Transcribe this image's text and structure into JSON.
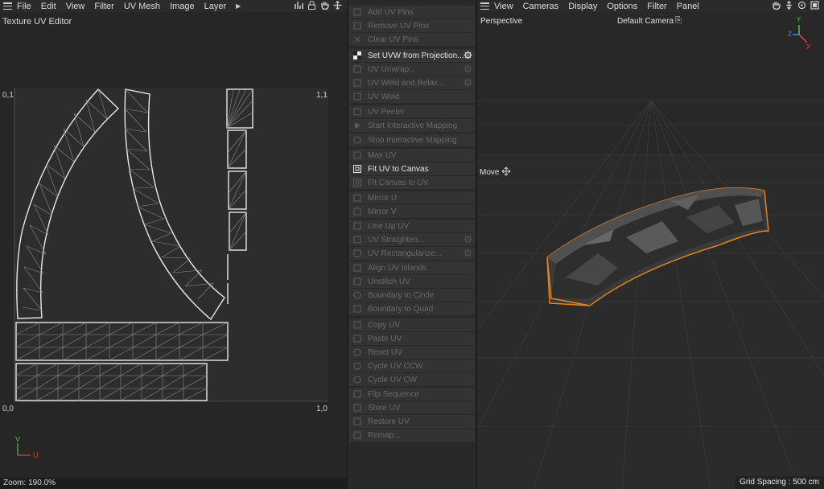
{
  "uv_editor": {
    "menu": [
      "File",
      "Edit",
      "View",
      "Filter",
      "UV Mesh",
      "Image",
      "Layer"
    ],
    "title": "Texture UV Editor",
    "corners": {
      "top_left": "0,1",
      "top_right": "1,1",
      "bottom_left": "0,0",
      "bottom_right": "1,0"
    },
    "axis": {
      "v": "V",
      "u": "U"
    },
    "status": "Zoom: 190.0%",
    "accent_colors": {
      "u_axis": "#e0453a",
      "v_axis": "#4bc24b"
    }
  },
  "commands": [
    {
      "label": "Add UV Pins",
      "enabled": false,
      "icon": "pin-icon"
    },
    {
      "label": "Remove UV Pins",
      "enabled": false,
      "icon": "pin-remove-icon"
    },
    {
      "label": "Clear UV Pins",
      "enabled": false,
      "icon": "x-icon"
    },
    {
      "label": "Set UVW from Projection...",
      "enabled": true,
      "icon": "checker-icon",
      "gear": true
    },
    {
      "label": "UV Unwrap...",
      "enabled": false,
      "icon": "unwrap-icon",
      "gear": true
    },
    {
      "label": "UV Weld and Relax...",
      "enabled": false,
      "icon": "weld-icon",
      "gear": true
    },
    {
      "label": "UV Weld",
      "enabled": false,
      "icon": "weld-icon"
    },
    {
      "label": "UV Peeler",
      "enabled": false,
      "icon": "peeler-icon"
    },
    {
      "label": "Start Interactive Mapping",
      "enabled": false,
      "icon": "play-icon"
    },
    {
      "label": "Stop Interactive Mapping",
      "enabled": false,
      "icon": "stop-icon"
    },
    {
      "label": "Max UV",
      "enabled": false,
      "icon": "max-icon"
    },
    {
      "label": "Fit UV to Canvas",
      "enabled": true,
      "icon": "fit-icon"
    },
    {
      "label": "Fit Canvas to UV",
      "enabled": false,
      "icon": "fit-icon"
    },
    {
      "label": "Mirror U",
      "enabled": false,
      "icon": "mirror-u-icon"
    },
    {
      "label": "Mirror V",
      "enabled": false,
      "icon": "mirror-v-icon"
    },
    {
      "label": "Line Up UV",
      "enabled": false,
      "icon": "line-icon"
    },
    {
      "label": "UV Straighten...",
      "enabled": false,
      "icon": "straighten-icon",
      "gear": true
    },
    {
      "label": "UV Rectangularize...",
      "enabled": false,
      "icon": "rect-icon",
      "gear": true
    },
    {
      "label": "Align UV Islands",
      "enabled": false,
      "icon": "align-icon"
    },
    {
      "label": "Unstitch UV",
      "enabled": false,
      "icon": "unstitch-icon"
    },
    {
      "label": "Boundary to Circle",
      "enabled": false,
      "icon": "circle-icon"
    },
    {
      "label": "Boundary to Quad",
      "enabled": false,
      "icon": "quad-icon"
    },
    {
      "label": "Copy UV",
      "enabled": false,
      "icon": "copy-icon"
    },
    {
      "label": "Paste UV",
      "enabled": false,
      "icon": "paste-icon"
    },
    {
      "label": "Reset UV",
      "enabled": false,
      "icon": "reset-icon"
    },
    {
      "label": "Cycle UV CCW",
      "enabled": false,
      "icon": "cycle-ccw-icon"
    },
    {
      "label": "Cycle UV CW",
      "enabled": false,
      "icon": "cycle-cw-icon"
    },
    {
      "label": "Flip Sequence",
      "enabled": false,
      "icon": "flip-icon"
    },
    {
      "label": "Store UV",
      "enabled": false,
      "icon": "store-icon"
    },
    {
      "label": "Restore UV",
      "enabled": false,
      "icon": "restore-icon"
    },
    {
      "label": "Remap...",
      "enabled": false,
      "icon": "remap-icon"
    }
  ],
  "viewport": {
    "menu": [
      "View",
      "Cameras",
      "Display",
      "Options",
      "Filter",
      "Panel"
    ],
    "view_name": "Perspective",
    "camera": "Default Camera",
    "tool": "Move",
    "axis": {
      "y": "Y",
      "z": "Z",
      "x": "X"
    },
    "grid_spacing": "Grid Spacing : 500 cm",
    "accent_colors": {
      "selection": "#e8861a",
      "x_axis": "#e0453a",
      "y_axis": "#4bc24b",
      "z_axis": "#3d8de0"
    }
  }
}
